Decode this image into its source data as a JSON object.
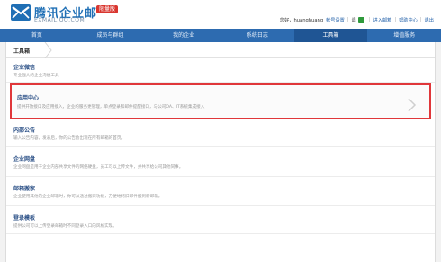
{
  "brand": {
    "name": "腾讯企业邮",
    "badge": "限量版",
    "domain": "EXMAIL.QQ.COM",
    "accent": "#1f6fb5"
  },
  "topbar": {
    "greeting": "您好，huanghuang",
    "account_link": "帐号设置",
    "exit_link": "退",
    "my_mail": "进入邮箱",
    "help": "帮助中心",
    "logout": "退出"
  },
  "nav": {
    "items": [
      {
        "label": "首页"
      },
      {
        "label": "成员与群组"
      },
      {
        "label": "我的企业"
      },
      {
        "label": "系统日志"
      },
      {
        "label": "工具箱",
        "active": true
      },
      {
        "label": "增值服务"
      }
    ]
  },
  "breadcrumb": {
    "label": "工具箱"
  },
  "tools": [
    {
      "title": "企业微信",
      "desc": "专业强大的企业沟通工具"
    },
    {
      "title": "应用中心",
      "desc": "提供开放接口及应用接入，企业的服务更管理，单点登录和邮件提醒接口，与公司OA、IT系统集成接入",
      "highlight": true
    },
    {
      "title": "内部公告",
      "desc": "输入公告内容，发表后，你的公告会出现在所有邮箱的首页。"
    },
    {
      "title": "企业网盘",
      "desc": "企业网盘是用于企业内部共享文件的网络硬盘，员工可以上传文件，并共享给公司其他同事。"
    },
    {
      "title": "邮箱搬家",
      "desc": "企业使用其他的企业邮箱时，你可以通过搬家功能，方便地将旧邮件搬到新邮箱。"
    },
    {
      "title": "登录模板",
      "desc": "提供公司可以上传登录邮箱时不同登录入口的风格实现。"
    }
  ],
  "colors": {
    "nav_bg": "#2d6bb0",
    "nav_active": "#1f5594",
    "highlight_border": "#e0373a",
    "title_color": "#2a4f86"
  }
}
